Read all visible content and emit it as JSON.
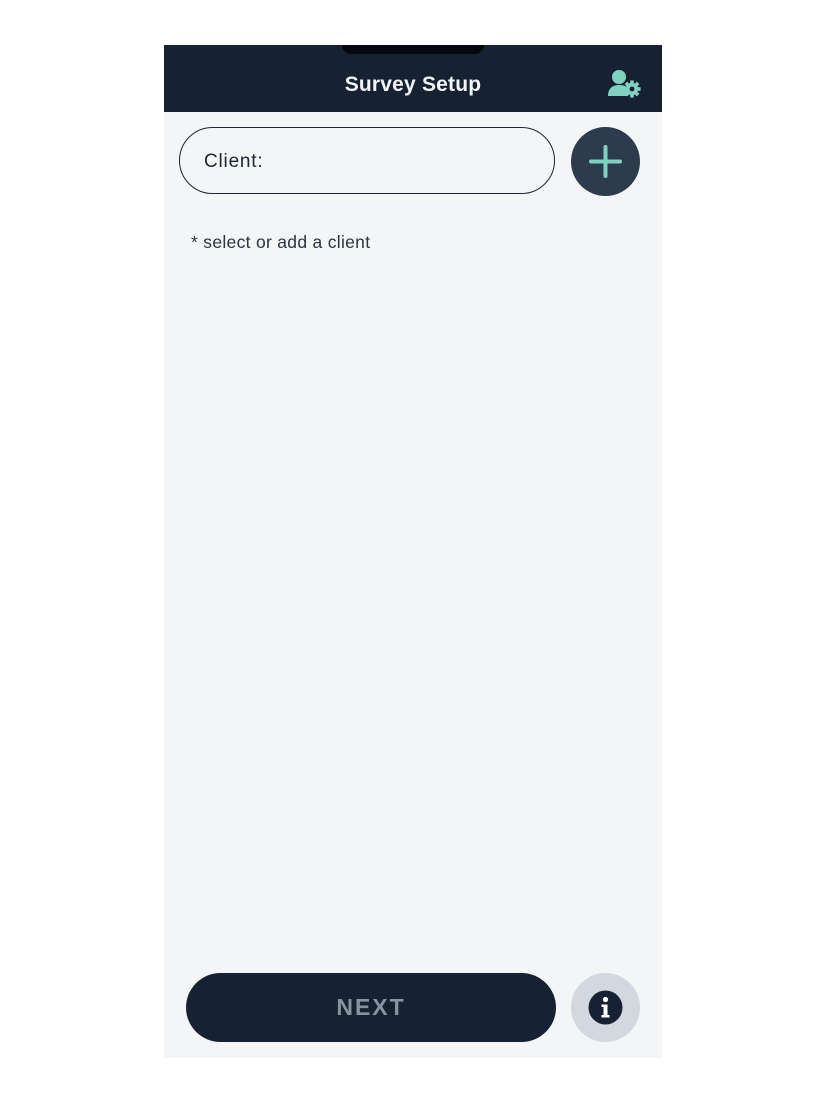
{
  "header": {
    "title": "Survey Setup",
    "settings_icon": "user-settings-icon"
  },
  "client": {
    "label": "Client:",
    "value": "",
    "add_icon": "plus-icon"
  },
  "helper_text": "* select or add a client",
  "footer": {
    "next_label": "NEXT",
    "info_icon": "info-icon"
  },
  "colors": {
    "header_bg": "#162231",
    "accent_teal": "#7fd1c2",
    "page_bg": "#f3f5f7",
    "add_button_bg": "#2d3b4d",
    "next_button_bg": "#162231",
    "next_label_disabled": "#8a949f",
    "info_button_bg": "#d3d8e0"
  }
}
